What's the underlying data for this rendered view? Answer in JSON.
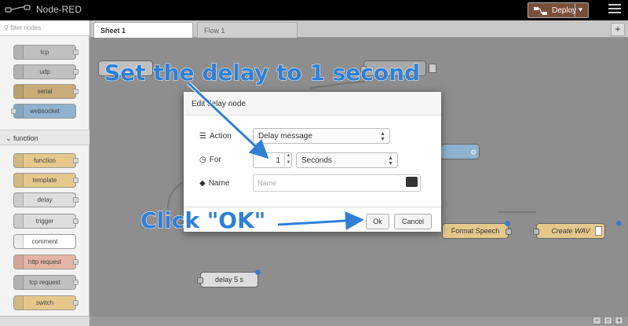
{
  "app": {
    "title": "Node-RED"
  },
  "header": {
    "deploy_label": "Deploy",
    "menu_icon": "hamburger-icon"
  },
  "palette": {
    "filter_placeholder": "filter nodes",
    "top_nodes": [
      {
        "label": "tcp",
        "color": "#c0c0c0"
      },
      {
        "label": "udp",
        "color": "#c0c0c0"
      },
      {
        "label": "serial",
        "color": "#c9ac78"
      },
      {
        "label": "websocket",
        "color": "#8fb2d0"
      }
    ],
    "category_label": "function",
    "function_nodes": [
      {
        "label": "function",
        "color": "#e6c88d"
      },
      {
        "label": "template",
        "color": "#e6c88d"
      },
      {
        "label": "delay",
        "color": "#dddddd"
      },
      {
        "label": "trigger",
        "color": "#dddddd"
      },
      {
        "label": "comment",
        "color": "#ffffff"
      },
      {
        "label": "http request",
        "color": "#e5b4a7"
      },
      {
        "label": "tcp request",
        "color": "#c0c0c0"
      },
      {
        "label": "switch",
        "color": "#e6c88d"
      }
    ]
  },
  "tabs": [
    {
      "label": "Sheet 1"
    },
    {
      "label": "Flow 1"
    }
  ],
  "canvas": {
    "nodes": [
      {
        "label": "delay 5 s",
        "color": "#dddddd"
      },
      {
        "label": "Format Speech",
        "color": "#e6c88d"
      },
      {
        "label": "Create WAV",
        "color": "#e6c88d"
      }
    ]
  },
  "dialog": {
    "title": "Edit delay node",
    "action_label": "Action",
    "action_value": "Delay message",
    "for_label": "For",
    "for_value": "1",
    "unit_value": "Seconds",
    "name_label": "Name",
    "name_placeholder": "Name",
    "ok_label": "Ok",
    "cancel_label": "Cancel"
  },
  "annotations": {
    "step1": "Set the delay to 1 second",
    "step2": "Click \"OK\""
  },
  "colors": {
    "accent": "#2f7fd6",
    "deploy": "#7a4f3a"
  }
}
